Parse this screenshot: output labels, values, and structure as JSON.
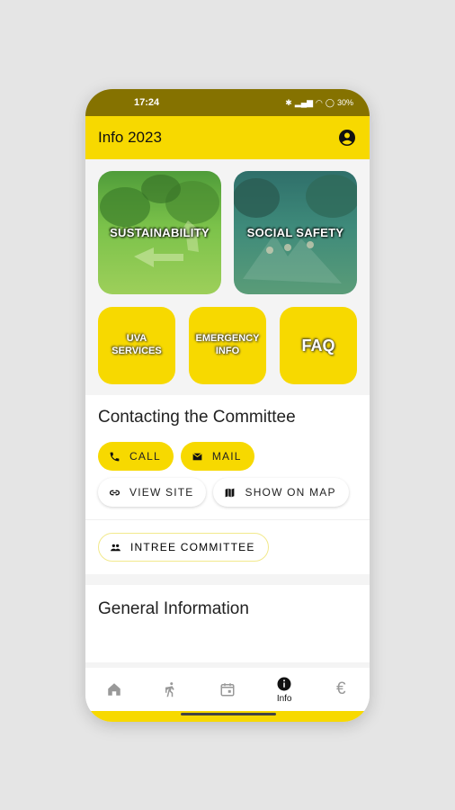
{
  "status": {
    "time": "17:24",
    "battery": "30%"
  },
  "appbar": {
    "title": "Info 2023",
    "account_icon": "account-circle-icon"
  },
  "tiles": {
    "sustainability": "SUSTAINABILITY",
    "social_safety": "SOCIAL SAFETY",
    "uva_services": "UVA SERVICES",
    "emergency_info": "EMERGENCY INFO",
    "faq": "FAQ"
  },
  "contact": {
    "title": "Contacting the Committee",
    "call": "CALL",
    "mail": "MAIL",
    "view_site": "VIEW SITE",
    "show_on_map": "SHOW ON MAP",
    "committee": "INTREE COMMITTEE"
  },
  "general": {
    "title": "General Information"
  },
  "nav": {
    "items": [
      {
        "icon": "home-icon",
        "label": ""
      },
      {
        "icon": "walking-person-icon",
        "label": ""
      },
      {
        "icon": "calendar-icon",
        "label": ""
      },
      {
        "icon": "info-icon",
        "label": "Info"
      },
      {
        "icon": "euro-icon",
        "label": ""
      }
    ]
  },
  "colors": {
    "accent": "#f7d900",
    "status_bar": "#857200"
  }
}
